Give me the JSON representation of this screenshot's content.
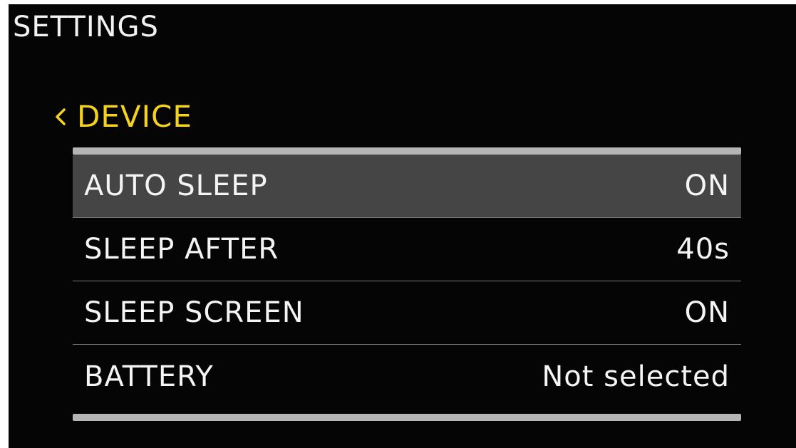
{
  "header": {
    "title": "SETTINGS"
  },
  "section": {
    "back_icon": "chevron-left-icon",
    "title": "DEVICE",
    "accent_color": "#f3d31b"
  },
  "menu": {
    "selected_index": 0,
    "items": [
      {
        "label": "AUTO SLEEP",
        "value": "ON"
      },
      {
        "label": "SLEEP AFTER",
        "value": "40s"
      },
      {
        "label": "SLEEP SCREEN",
        "value": "ON"
      },
      {
        "label": "BATTERY",
        "value": "Not selected"
      }
    ]
  }
}
